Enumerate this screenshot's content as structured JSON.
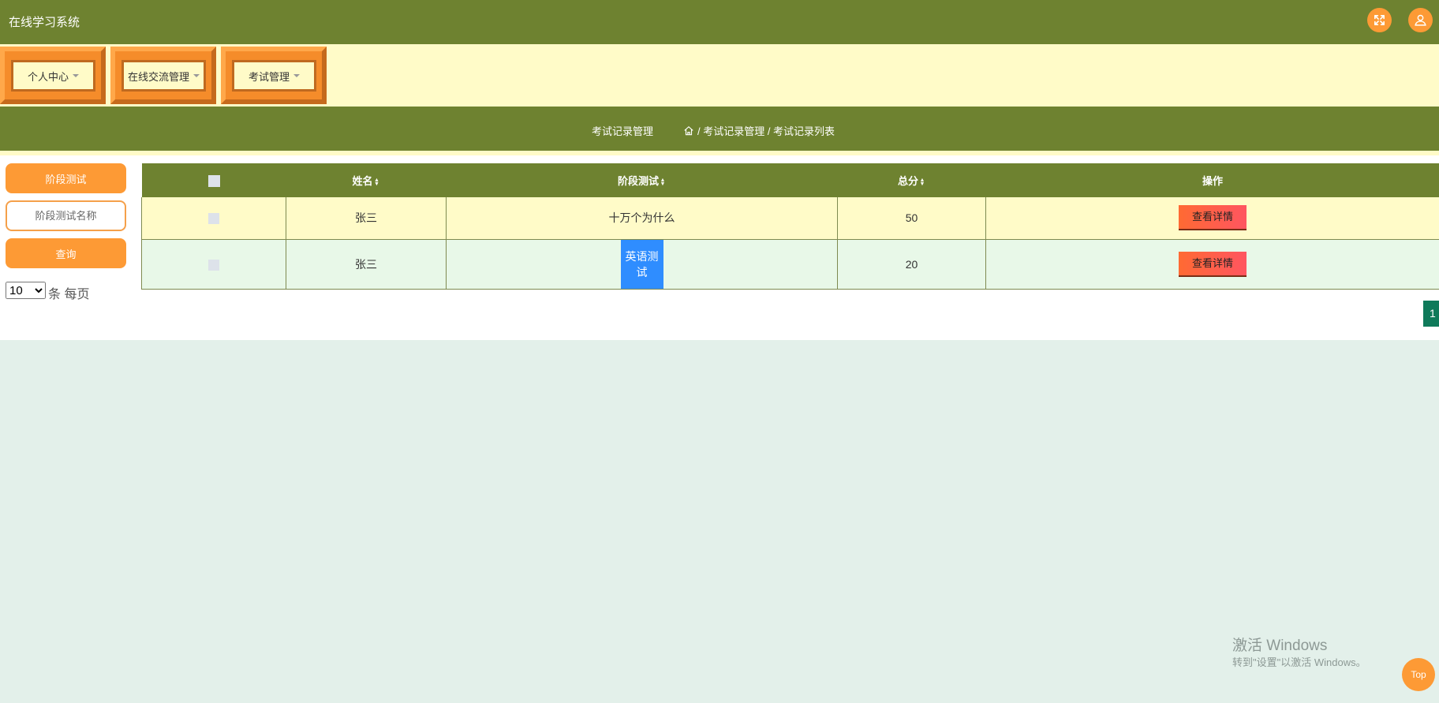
{
  "app": {
    "title": "在线学习系统"
  },
  "header": {
    "fullscreen_icon": "expand-arrows-icon",
    "user_icon": "user-icon"
  },
  "menu": {
    "items": [
      {
        "label": "个人中心"
      },
      {
        "label": "在线交流管理"
      },
      {
        "label": "考试管理"
      }
    ]
  },
  "breadcrumb": {
    "section_title": "考试记录管理",
    "home_icon": "home-icon",
    "path": "/ 考试记录管理 / 考试记录列表"
  },
  "sidebar": {
    "filter_button": "阶段测试",
    "search_placeholder": "阶段测试名称",
    "query_button": "查询",
    "page_size": "10",
    "page_size_suffix": "条 每页"
  },
  "table": {
    "headers": {
      "name": "姓名",
      "test": "阶段测试",
      "score": "总分",
      "actions": "操作"
    },
    "rows": [
      {
        "name": "张三",
        "test": "十万个为什么",
        "score": "50",
        "action": "查看详情"
      },
      {
        "name": "张三",
        "test": "英语测试",
        "score": "20",
        "action": "查看详情"
      }
    ]
  },
  "pagination": {
    "current": "1"
  },
  "watermark": {
    "line1": "激活 Windows",
    "line2": "转到\"设置\"以激活 Windows。"
  },
  "scroll_top": {
    "label": "Top"
  },
  "colors": {
    "header_bg": "#6e8230",
    "accent": "#fd9a35",
    "menu_bg": "#fffbc8"
  }
}
